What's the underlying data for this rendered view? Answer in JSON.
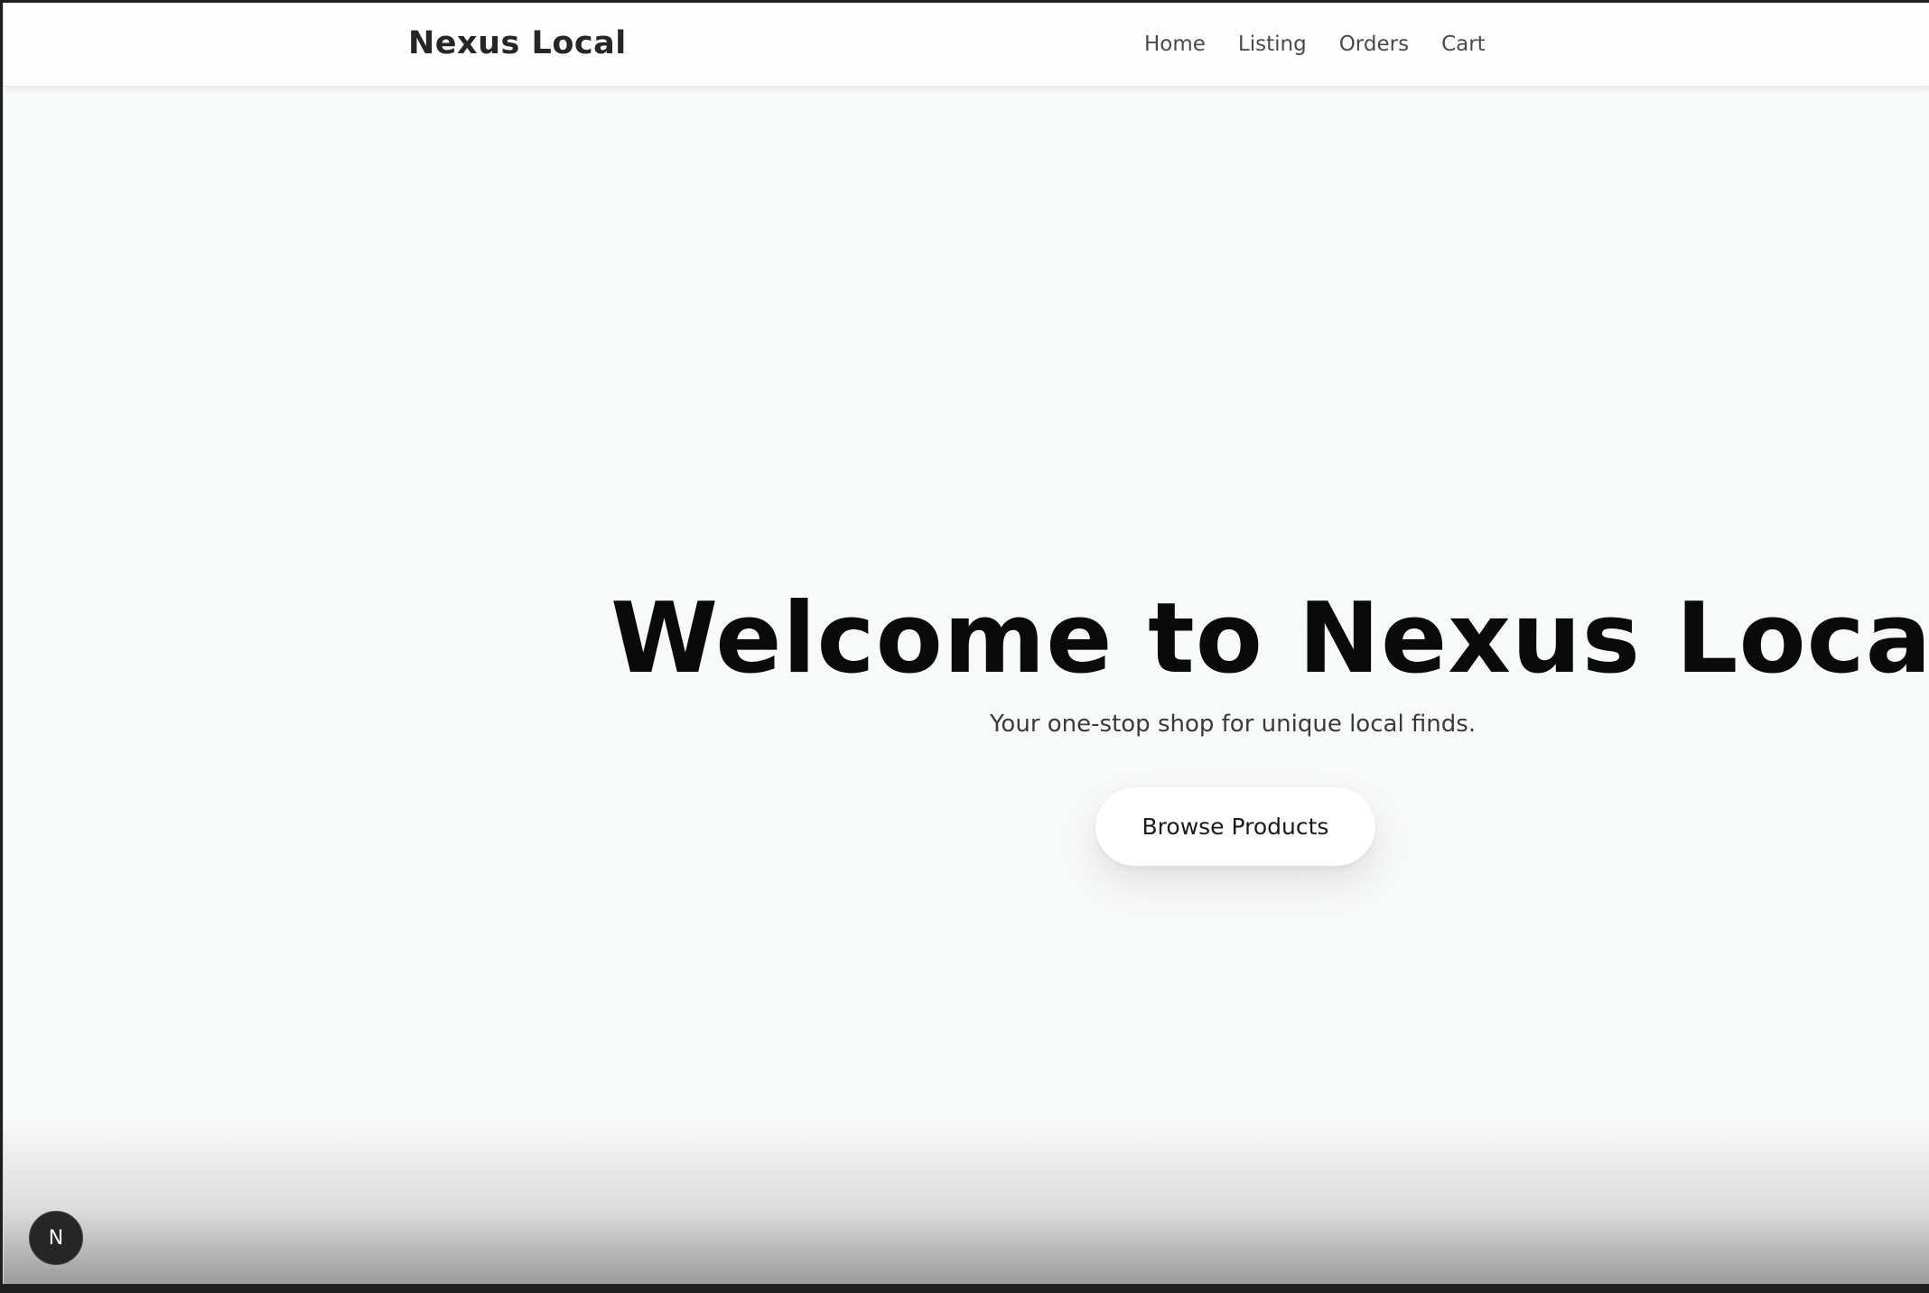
{
  "header": {
    "brand": "Nexus Local",
    "nav": [
      "Home",
      "Listing",
      "Orders",
      "Cart"
    ]
  },
  "hero": {
    "title": "Welcome to Nexus Local",
    "subtitle": "Your one-stop shop for unique local finds.",
    "cta_label": "Browse Products"
  },
  "devtools": {
    "badge_letter": "N",
    "icon": "nextjs-dev-indicator-icon"
  },
  "colors": {
    "background": "#f8f9f9",
    "header_bg": "#fefefe",
    "title_text": "#0a0a0a",
    "badge_bg": "#262626"
  }
}
